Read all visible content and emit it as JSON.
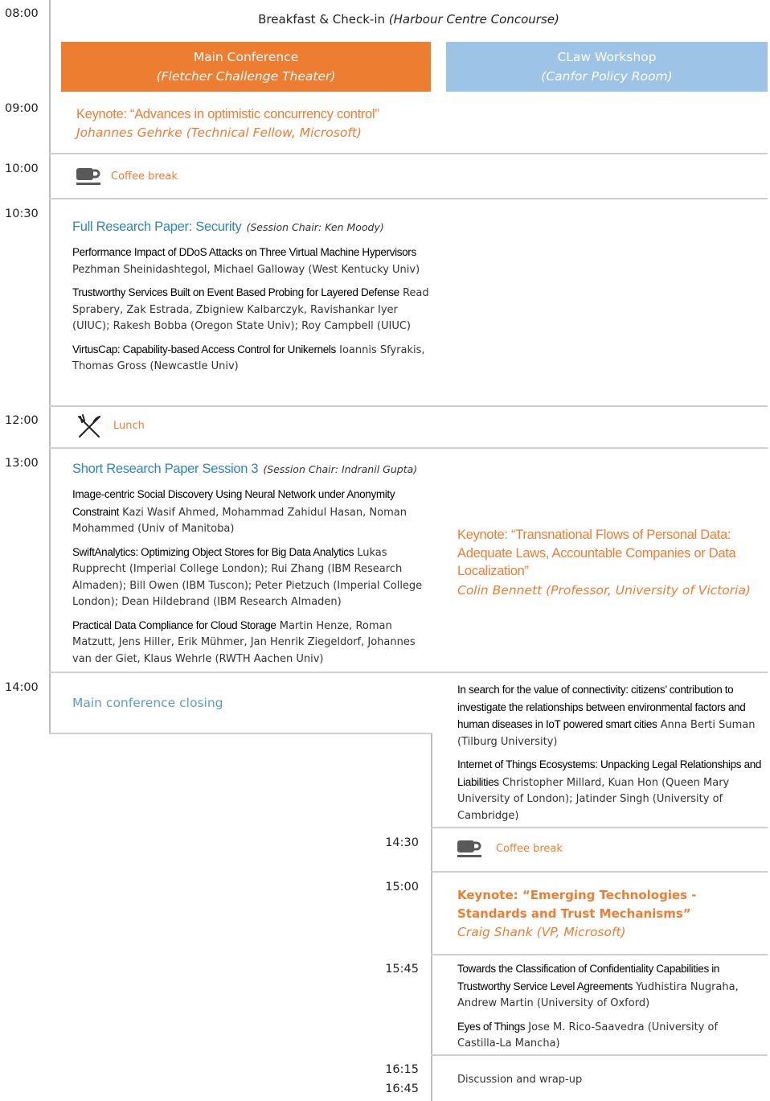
{
  "times": {
    "t0800": "08:00",
    "t0900": "09:00",
    "t1000": "10:00",
    "t1030": "10:30",
    "t1200": "12:00",
    "t1300": "13:00",
    "t1400": "14:00",
    "t1430": "14:30",
    "t1500": "15:00",
    "t1545": "15:45",
    "t1615": "16:15",
    "t1645": "16:45"
  },
  "breakfast": {
    "label": "Breakfast & Check-in",
    "location": "(Harbour Centre Concourse)"
  },
  "tracks": {
    "main": {
      "title": "Main Conference",
      "location": "(Fletcher Challenge Theater)"
    },
    "claw": {
      "title": "CLaw Workshop",
      "location": "(Canfor Policy Room)"
    }
  },
  "keynote1": {
    "title": "Keynote: “Advances in optimistic concurrency control”",
    "speaker": "Johannes Gehrke (Technical Fellow, Microsoft)"
  },
  "coffee1": {
    "label": "Coffee break"
  },
  "session1": {
    "title": "Full Research Paper: Security",
    "chair": "(Session Chair: Ken Moody)",
    "papers": [
      {
        "title": "Performance Impact of DDoS Attacks on Three Virtual Machine Hypervisors",
        "authors": "Pezhman Sheinidashtegol, Michael Galloway (West Kentucky Univ)"
      },
      {
        "title": "Trustworthy Services Built on Event Based Probing for Layered Defense",
        "authors": "Read Sprabery, Zak Estrada, Zbigniew Kalbarczyk, Ravishankar Iyer (UIUC); Rakesh Bobba (Oregon State Univ); Roy Campbell (UIUC)"
      },
      {
        "title": "VirtusCap: Capability-based Access Control for Unikernels",
        "authors": "Ioannis Sfyrakis, Thomas Gross (Newcastle Univ)"
      }
    ]
  },
  "lunch": {
    "label": "Lunch"
  },
  "session2": {
    "title": "Short Research Paper Session 3",
    "chair": "(Session Chair: Indranil Gupta)",
    "papers": [
      {
        "title": "Image-centric Social Discovery Using Neural Network under Anonymity Constraint",
        "authors": "Kazi Wasif Ahmed, Mohammad Zahidul Hasan, Noman Mohammed (Univ of Manitoba)"
      },
      {
        "title": "SwiftAnalytics: Optimizing Object Stores for Big Data Analytics",
        "authors": "Lukas Rupprecht (Imperial College London); Rui Zhang (IBM Research Almaden); Bill Owen (IBM Tuscon); Peter Pietzuch (Imperial College London); Dean Hildebrand (IBM Research Almaden)"
      },
      {
        "title": "Practical Data Compliance for Cloud Storage",
        "authors": "Martin Henze, Roman Matzutt, Jens Hiller, Erik Mühmer, Jan Henrik Ziegeldorf, Johannes van der Giet, Klaus Wehrle (RWTH Aachen Univ)"
      }
    ]
  },
  "keynote2": {
    "title": "Keynote: “Transnational Flows of Personal Data: Adequate Laws, Accountable Companies or Data Localization”",
    "speaker": "Colin Bennett (Professor, University of Victoria)"
  },
  "closing": {
    "label": "Main conference closing"
  },
  "claw_papers1": [
    {
      "title": "In search for the value of connectivity: citizens’ contribution to investigate the relationships between environmental factors and human diseases in IoT powered smart cities",
      "authors": "Anna Berti Suman (Tilburg University)"
    },
    {
      "title": "Internet of Things Ecosystems: Unpacking Legal Relationships and Liabilities",
      "authors": "Christopher Millard, Kuan Hon (Queen Mary University of London); Jatinder Singh (University of Cambridge)"
    }
  ],
  "coffee2": {
    "label": "Coffee break"
  },
  "keynote3": {
    "title": "Keynote: “Emerging Technologies - Standards and Trust Mechanisms”",
    "speaker": "Craig Shank (VP, Microsoft)"
  },
  "claw_papers2": [
    {
      "title": "Towards the Classification of Confidentiality Capabilities in Trustworthy Service Level Agreements",
      "authors": "Yudhistira Nugraha, Andrew Martin (University of Oxford)"
    },
    {
      "title": "Eyes of Things",
      "authors": "Jose M. Rico-Saavedra (University of Castilla-La Mancha)"
    }
  ],
  "wrapup": {
    "label": "Discussion and wrap-up"
  },
  "colors": {
    "orange": "#ed7d31",
    "light_blue": "#9dc3e6",
    "blue_text": "#2e86c1",
    "closing_blue": "#5b9bd5"
  },
  "icons": {
    "coffee": "coffee-cup-icon",
    "lunch": "fork-knife-icon"
  }
}
